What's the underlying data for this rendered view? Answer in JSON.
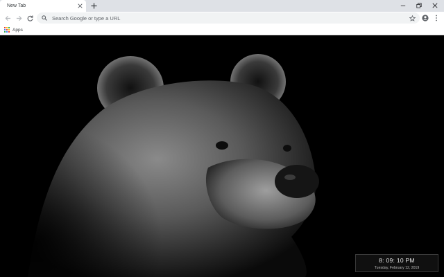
{
  "browser": {
    "tab": {
      "title": "New Tab"
    },
    "omnibox": {
      "placeholder": "Search Google or type a URL",
      "value": ""
    },
    "bookmarks": {
      "apps_label": "Apps"
    }
  },
  "page": {
    "clock": {
      "time": "8: 09: 10 PM",
      "date": "Tuesday, February 12, 2019"
    }
  },
  "colors": {
    "tabstrip": "#dee1e6",
    "toolbar": "#ffffff",
    "omnibox": "#f1f3f4",
    "icon": "#5f6368",
    "content_bg": "#000000"
  },
  "icons": {
    "back": "arrow-left-icon",
    "forward": "arrow-right-icon",
    "reload": "reload-icon",
    "search": "search-icon",
    "bookmark": "star-icon",
    "account": "account-circle-icon",
    "menu": "three-dots-vertical-icon",
    "apps": "apps-grid-icon",
    "minimize": "minimize-icon",
    "restore": "restore-icon",
    "close": "close-icon",
    "new_tab": "plus-icon"
  }
}
